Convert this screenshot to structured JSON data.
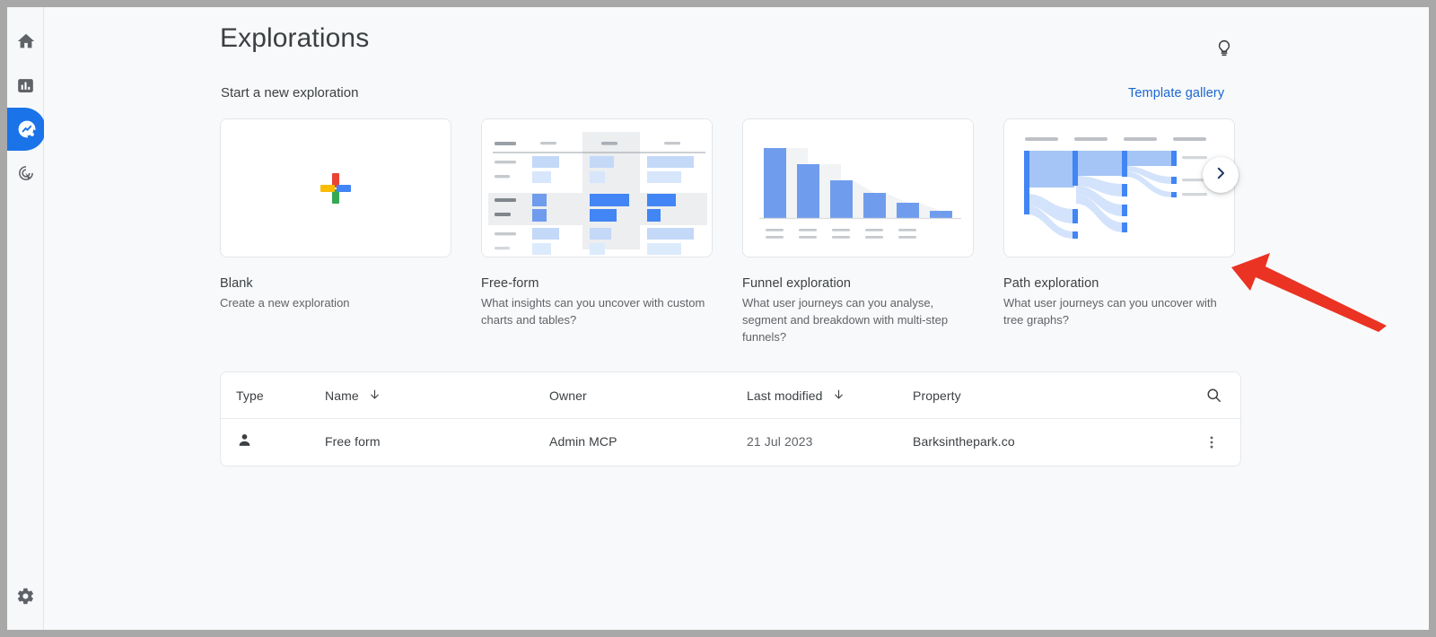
{
  "window": {
    "frame_color": "#a8a8a8",
    "background": "#f8f9fa"
  },
  "sidebar": {
    "items": [
      {
        "name": "home",
        "icon": "home-icon",
        "active": false
      },
      {
        "name": "reports",
        "icon": "bar-chart-icon",
        "active": false
      },
      {
        "name": "explore",
        "icon": "explore-icon",
        "active": true
      },
      {
        "name": "advertising",
        "icon": "advertising-target-icon",
        "active": false
      }
    ],
    "footer": {
      "name": "admin",
      "icon": "gear-icon",
      "label": "Admin"
    }
  },
  "header": {
    "title": "Explorations",
    "tips_icon": "lightbulb-icon"
  },
  "start_section": {
    "subtitle": "Start a new exploration",
    "template_gallery_label": "Template gallery",
    "next_button_icon": "chevron-right-icon"
  },
  "cards": [
    {
      "title": "Blank",
      "description": "Create a new exploration",
      "thumb": "plus-icon"
    },
    {
      "title": "Free-form",
      "description": "What insights can you uncover with custom charts and tables?",
      "thumb": "free-form-table-thumbnail"
    },
    {
      "title": "Funnel exploration",
      "description": "What user journeys can you analyse, segment and breakdown with multi-step funnels?",
      "thumb": "funnel-bar-chart-thumbnail"
    },
    {
      "title": "Path exploration",
      "description": "What user journeys can you uncover with tree graphs?",
      "thumb": "path-sankey-thumbnail"
    }
  ],
  "table": {
    "columns": [
      {
        "key": "type",
        "label": "Type",
        "sortable": false
      },
      {
        "key": "name",
        "label": "Name",
        "sortable": true,
        "sort_icon": "arrow-down-icon"
      },
      {
        "key": "owner",
        "label": "Owner",
        "sortable": false
      },
      {
        "key": "modified",
        "label": "Last modified",
        "sortable": true,
        "sort_icon": "arrow-down-icon"
      },
      {
        "key": "property",
        "label": "Property",
        "sortable": false
      }
    ],
    "search_icon": "search-icon",
    "rows": [
      {
        "type_icon": "person-icon",
        "name": "Free form",
        "owner": "Admin MCP",
        "modified": "21 Jul 2023",
        "property": "Barksinthepark.co",
        "menu_icon": "more-vertical-icon"
      }
    ]
  },
  "annotation": {
    "arrow_color": "#ea3323",
    "points_at": "path-exploration-card"
  },
  "colors": {
    "accent_blue": "#1a73e8",
    "link_blue": "#1967d2",
    "text_primary": "#3c4043",
    "text_secondary": "#5f6368",
    "chart_blue": "#6f9ced",
    "chart_blue_light": "#c4d8f8"
  }
}
